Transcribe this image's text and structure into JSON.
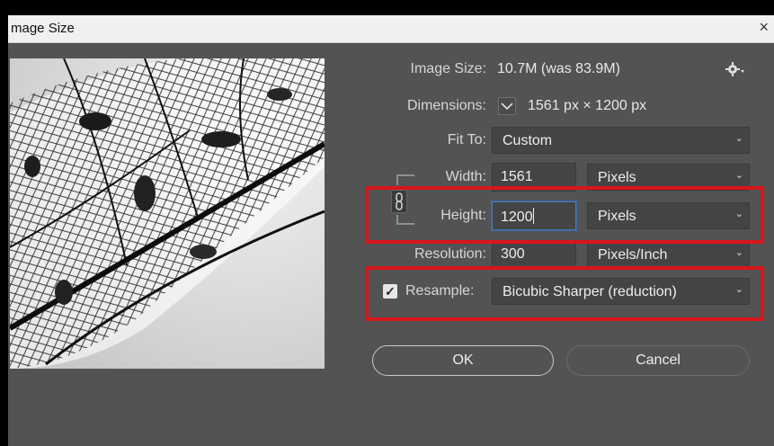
{
  "dialog": {
    "title": "mage Size",
    "close_symbol": "×"
  },
  "info": {
    "image_size_label": "Image Size:",
    "image_size_value": "10.7M (was 83.9M)",
    "dimensions_label": "Dimensions:",
    "dimensions_value": "1561 px  ×  1200 px",
    "gear_icon": "gear-icon"
  },
  "fit_to": {
    "label": "Fit To:",
    "value": "Custom"
  },
  "width": {
    "label": "Width:",
    "value": "1561",
    "unit": "Pixels"
  },
  "height": {
    "label": "Height:",
    "value": "1200",
    "unit": "Pixels"
  },
  "resolution": {
    "label": "Resolution:",
    "value": "300",
    "unit": "Pixels/Inch"
  },
  "resample": {
    "label": "Resample:",
    "checked": true,
    "method": "Bicubic Sharper (reduction)"
  },
  "buttons": {
    "ok": "OK",
    "cancel": "Cancel"
  },
  "colors": {
    "dialog_bg": "#535353",
    "field_bg": "#454545",
    "highlight_red": "#d8161b",
    "focus_blue": "#4b78b4"
  }
}
